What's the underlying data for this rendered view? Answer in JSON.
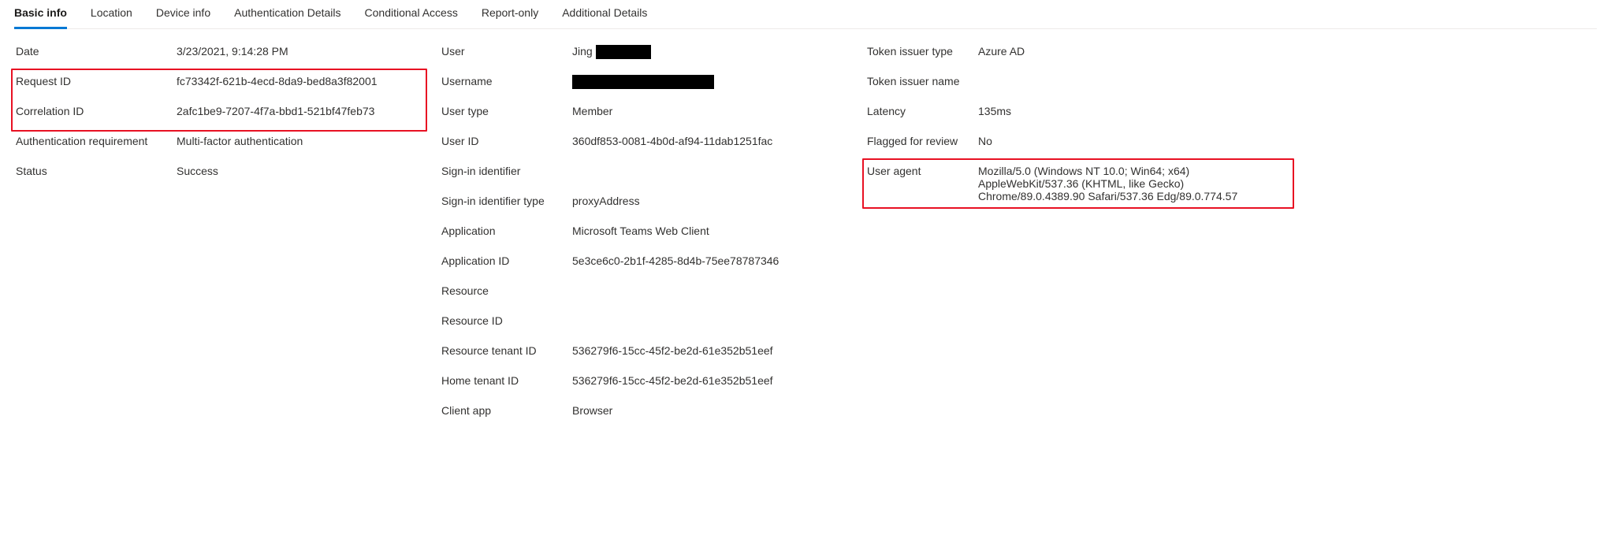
{
  "tabs": {
    "basic_info": "Basic info",
    "location": "Location",
    "device_info": "Device info",
    "auth_details": "Authentication Details",
    "conditional_access": "Conditional Access",
    "report_only": "Report-only",
    "additional_details": "Additional Details"
  },
  "col1": {
    "date_label": "Date",
    "date_value": "3/23/2021, 9:14:28 PM",
    "request_id_label": "Request ID",
    "request_id_value": "fc73342f-621b-4ecd-8da9-bed8a3f82001",
    "correlation_id_label": "Correlation ID",
    "correlation_id_value": "2afc1be9-7207-4f7a-bbd1-521bf47feb73",
    "auth_req_label": "Authentication requirement",
    "auth_req_value": "Multi-factor authentication",
    "status_label": "Status",
    "status_value": "Success"
  },
  "col2": {
    "user_label": "User",
    "user_value_visible": "Jing",
    "username_label": "Username",
    "user_type_label": "User type",
    "user_type_value": "Member",
    "user_id_label": "User ID",
    "user_id_value": "360df853-0081-4b0d-af94-11dab1251fac",
    "signin_identifier_label": "Sign-in identifier",
    "signin_identifier_value": "",
    "signin_identifier_type_label": "Sign-in identifier type",
    "signin_identifier_type_value": "proxyAddress",
    "application_label": "Application",
    "application_value": "Microsoft Teams Web Client",
    "application_id_label": "Application ID",
    "application_id_value": "5e3ce6c0-2b1f-4285-8d4b-75ee78787346",
    "resource_label": "Resource",
    "resource_value": "",
    "resource_id_label": "Resource ID",
    "resource_id_value": "",
    "resource_tenant_id_label": "Resource tenant ID",
    "resource_tenant_id_value": "536279f6-15cc-45f2-be2d-61e352b51eef",
    "home_tenant_id_label": "Home tenant ID",
    "home_tenant_id_value": "536279f6-15cc-45f2-be2d-61e352b51eef",
    "client_app_label": "Client app",
    "client_app_value": "Browser"
  },
  "col3": {
    "token_issuer_type_label": "Token issuer type",
    "token_issuer_type_value": "Azure AD",
    "token_issuer_name_label": "Token issuer name",
    "token_issuer_name_value": "",
    "latency_label": "Latency",
    "latency_value": "135ms",
    "flagged_label": "Flagged for review",
    "flagged_value": "No",
    "user_agent_label": "User agent",
    "user_agent_value": "Mozilla/5.0 (Windows NT 10.0; Win64; x64) AppleWebKit/537.36 (KHTML, like Gecko) Chrome/89.0.4389.90 Safari/537.36 Edg/89.0.774.57"
  }
}
